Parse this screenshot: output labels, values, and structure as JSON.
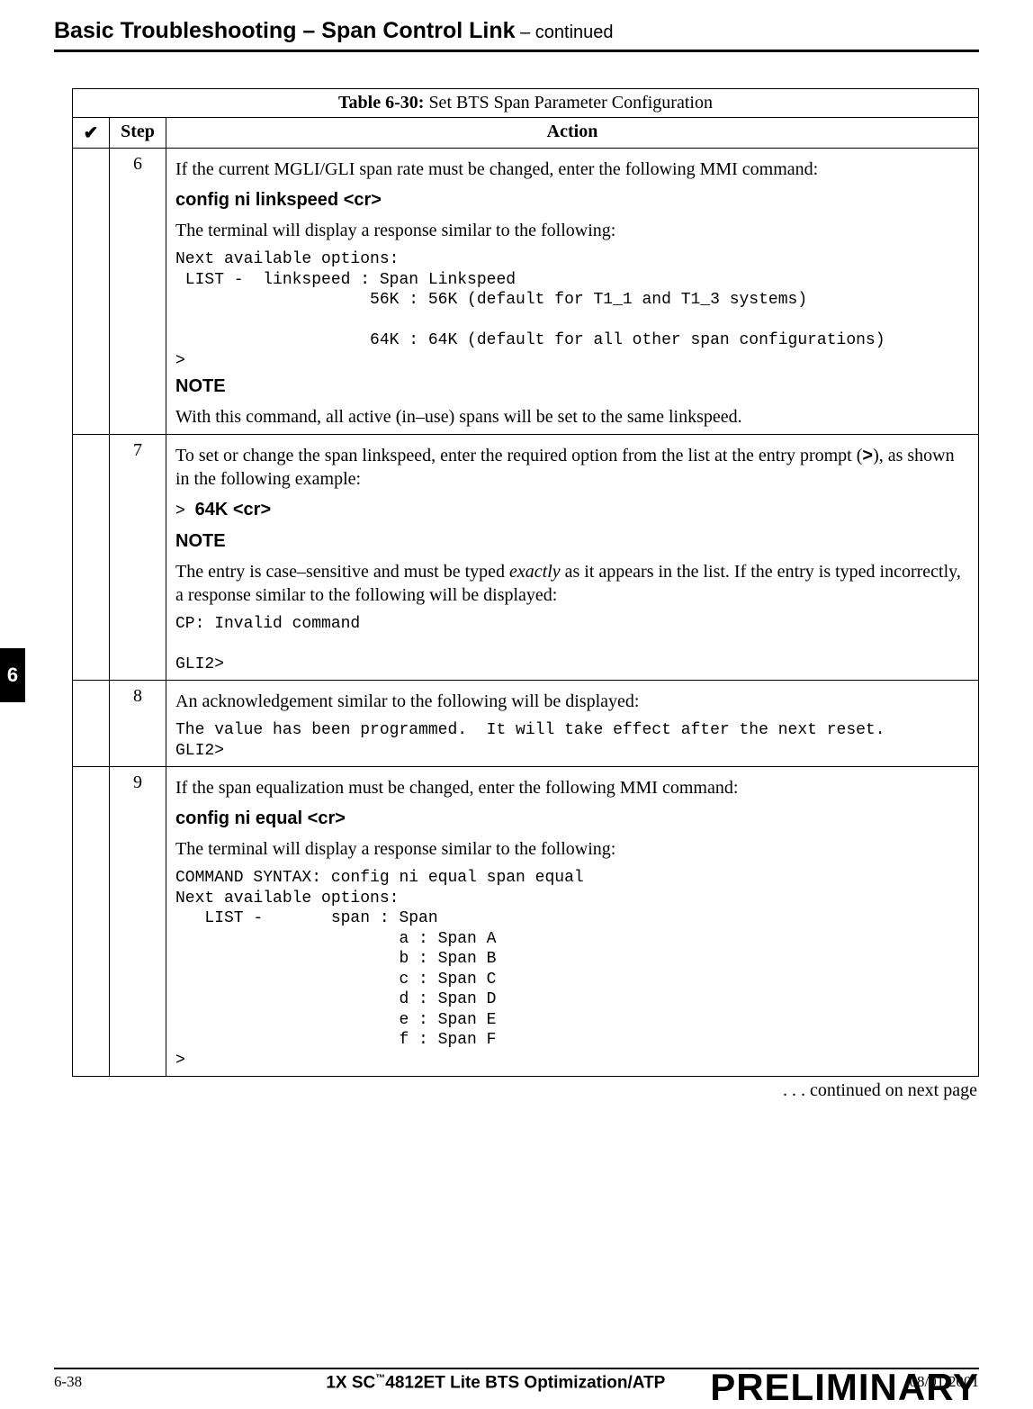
{
  "heading": {
    "bold": "Basic Troubleshooting – Span Control Link",
    "cont": " – continued"
  },
  "side_tab": "6",
  "table": {
    "title_bold": "Table 6-30:",
    "title_rest": " Set BTS Span Parameter Configuration",
    "headers": {
      "check": "✔",
      "step": "Step",
      "action": "Action"
    },
    "rows": {
      "r6": {
        "step": "6",
        "p1": "If the current MGLI/GLI span rate must be changed, enter the following MMI command:",
        "cmd": "config  ni  linkspeed     <cr>",
        "p2": "The terminal will display a response similar to the following:",
        "mono": "Next available options:\n LIST -  linkspeed : Span Linkspeed\n                    56K : 56K (default for T1_1 and T1_3 systems)\n\n                    64K : 64K (default for all other span configurations)\n>",
        "note_label": "NOTE",
        "note_text": "With this command, all active (in–use) spans will be set to the same linkspeed."
      },
      "r7": {
        "step": "7",
        "p1a": "To set or change the span linkspeed, enter the required option from the list at the entry prompt (",
        "p1b": ">",
        "p1c": "), as shown in the following example:",
        "cmd_prompt": "> ",
        "cmd": "64K   <cr>",
        "note_label": "NOTE",
        "note_text_a": "The entry is case–sensitive and must be typed ",
        "note_text_em": "exactly",
        "note_text_b": " as it appears in the list. If the entry is typed incorrectly, a response similar to the following will be displayed:",
        "mono": "CP: Invalid command\n\nGLI2>"
      },
      "r8": {
        "step": "8",
        "p1": "An acknowledgement similar to the following will be displayed:",
        "mono": "The value has been programmed.  It will take effect after the next reset.\nGLI2>"
      },
      "r9": {
        "step": "9",
        "p1": "If the span equalization must be changed, enter the following MMI command:",
        "cmd": "config ni equal   <cr>",
        "p2": "The terminal will display a response similar to the following:",
        "mono": "COMMAND SYNTAX: config ni equal span equal\nNext available options:\n   LIST -       span : Span\n                       a : Span A\n                       b : Span B\n                       c : Span C\n                       d : Span D\n                       e : Span E\n                       f : Span F\n>"
      }
    }
  },
  "continued": " . . . continued on next page",
  "footer": {
    "page": "6-38",
    "center_a": "1X SC",
    "center_tm": "™",
    "center_b": "4812ET Lite BTS Optimization/ATP",
    "date": "08/01/2001",
    "preliminary": "PRELIMINARY"
  }
}
